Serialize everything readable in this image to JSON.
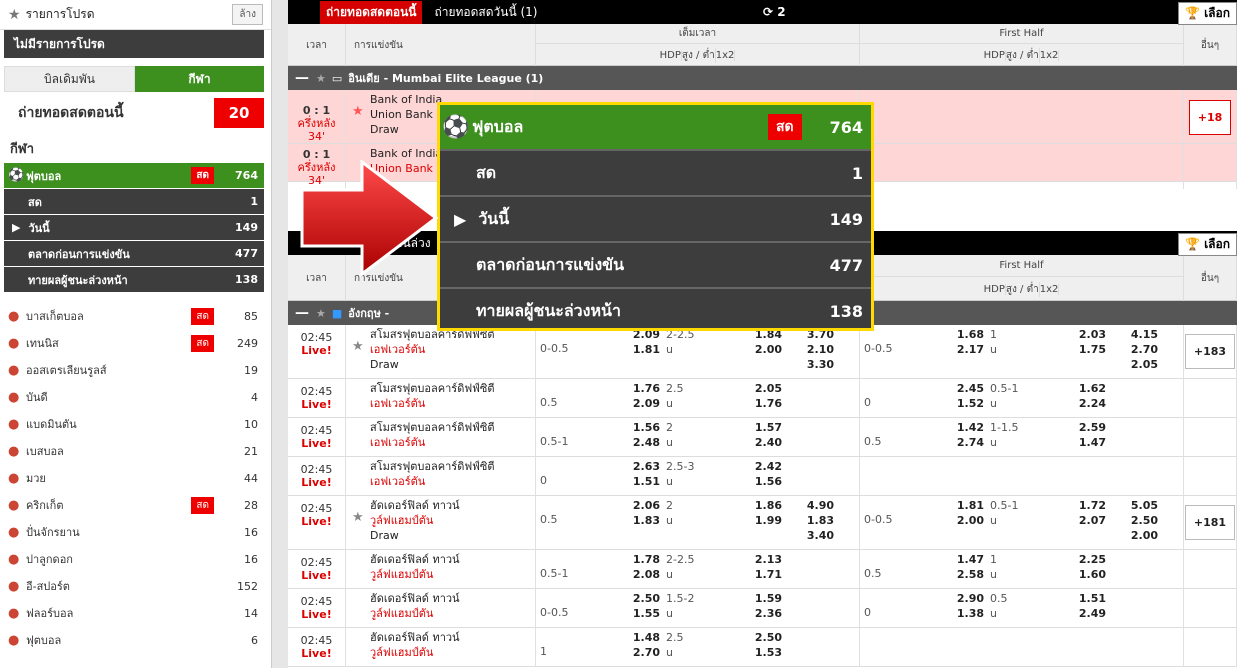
{
  "sidebar": {
    "fav_title": "รายการโปรด",
    "clear": "ล้าง",
    "no_fav": "ไม่มีรายการโปรด",
    "tab_bets": "บิลเดิมพัน",
    "tab_sports": "กีฬา",
    "live_now_label": "ถ่ายทอดสดตอนนี้",
    "live_now_count": "20",
    "sports_header": "กีฬา",
    "football": {
      "label": "ฟุตบอล",
      "live": "สด",
      "count": "764"
    },
    "subs": [
      {
        "label": "สด",
        "count": "1"
      },
      {
        "label": "วันนี้",
        "count": "149"
      },
      {
        "label": "ตลาดก่อนการแข่งขัน",
        "count": "477"
      },
      {
        "label": "ทายผลผู้ชนะล่วงหน้า",
        "count": "138"
      }
    ],
    "sports": [
      {
        "icon": "●",
        "label": "บาสเก็ตบอล",
        "live": "สด",
        "count": "85"
      },
      {
        "icon": "●",
        "label": "เทนนิส",
        "live": "สด",
        "count": "249"
      },
      {
        "icon": "●",
        "label": "ออสเตรเลียนรูลส์",
        "live": "",
        "count": "19"
      },
      {
        "icon": "●",
        "label": "บันดี",
        "live": "",
        "count": "4"
      },
      {
        "icon": "●",
        "label": "แบดมินตัน",
        "live": "",
        "count": "10"
      },
      {
        "icon": "●",
        "label": "เบสบอล",
        "live": "",
        "count": "21"
      },
      {
        "icon": "●",
        "label": "มวย",
        "live": "",
        "count": "44"
      },
      {
        "icon": "●",
        "label": "คริกเก็ต",
        "live": "สด",
        "count": "28"
      },
      {
        "icon": "●",
        "label": "ปั่นจักรยาน",
        "live": "",
        "count": "16"
      },
      {
        "icon": "●",
        "label": "ปาลูกดอก",
        "live": "",
        "count": "16"
      },
      {
        "icon": "●",
        "label": "อี-สปอร์ต",
        "live": "",
        "count": "152"
      },
      {
        "icon": "●",
        "label": "ฟลอร์บอล",
        "live": "",
        "count": "14"
      },
      {
        "icon": "●",
        "label": "ฟุตบอล",
        "live": "",
        "count": "6"
      }
    ]
  },
  "top": {
    "live_now": "ถ่ายทอดสดตอนนี้",
    "live_today": "ถ่ายทอดสดวันนี้ (1)",
    "refresh": "2",
    "choose": "เลือก"
  },
  "header": {
    "time": "เวลา",
    "match": "การแข่งขัน",
    "full": "เต็มเวลา",
    "first_half": "First Half",
    "hdp": "HDP",
    "ou": "สูง / ต่ำ",
    "x12": "1x2",
    "other": "อื่นๆ"
  },
  "league1": "อินเดีย - Mumbai Elite League (1)",
  "live_rows": [
    {
      "score": "0 : 1",
      "period": "ครึ่งหลัง 34'",
      "home": "Bank of India",
      "away": "Union Bank",
      "draw": "Draw",
      "more": "+18"
    },
    {
      "score": "0 : 1",
      "period": "ครึ่งหลัง 34'",
      "home": "Bank of India",
      "away": "Union Bank",
      "draw": "",
      "more": ""
    }
  ],
  "league2": "อังกฤษ -",
  "rows": [
    {
      "time": "02:45",
      "live": "Live!",
      "home": "สโมสรฟุตบอลคาร์ดิฟฟ์ซิตี",
      "away": "เอฟเวอร์ตัน",
      "draw": "Draw",
      "fh": "0-0.5",
      "fo1": "2.09",
      "fo2": "1.81",
      "fou": "2-2.5",
      "fu": "u",
      "fuo1": "1.84",
      "fuo2": "2.00",
      "x1": "3.70",
      "x2": "2.10",
      "x3": "3.30",
      "hh": "0-0.5",
      "ho1": "1.68",
      "ho2": "2.17",
      "hou": "1",
      "hu": "u",
      "huo1": "2.03",
      "huo2": "1.75",
      "hx1": "4.15",
      "hx2": "2.70",
      "hx3": "2.05",
      "more": "+183"
    },
    {
      "time": "02:45",
      "live": "Live!",
      "home": "สโมสรฟุตบอลคาร์ดิฟฟ์ซิตี",
      "away": "เอฟเวอร์ตัน",
      "draw": "",
      "fh": "0.5",
      "fo1": "1.76",
      "fo2": "2.09",
      "fou": "2.5",
      "fu": "u",
      "fuo1": "2.05",
      "fuo2": "1.76",
      "x1": "",
      "x2": "",
      "x3": "",
      "hh": "0",
      "ho1": "2.45",
      "ho2": "1.52",
      "hou": "0.5-1",
      "hu": "u",
      "huo1": "1.62",
      "huo2": "2.24",
      "hx1": "",
      "hx2": "",
      "hx3": "",
      "more": ""
    },
    {
      "time": "02:45",
      "live": "Live!",
      "home": "สโมสรฟุตบอลคาร์ดิฟฟ์ซิตี",
      "away": "เอฟเวอร์ตัน",
      "draw": "",
      "fh": "0.5-1",
      "fo1": "1.56",
      "fo2": "2.48",
      "fou": "2",
      "fu": "u",
      "fuo1": "1.57",
      "fuo2": "2.40",
      "x1": "",
      "x2": "",
      "x3": "",
      "hh": "0.5",
      "ho1": "1.42",
      "ho2": "2.74",
      "hou": "1-1.5",
      "hu": "u",
      "huo1": "2.59",
      "huo2": "1.47",
      "hx1": "",
      "hx2": "",
      "hx3": "",
      "more": ""
    },
    {
      "time": "02:45",
      "live": "Live!",
      "home": "สโมสรฟุตบอลคาร์ดิฟฟ์ซิตี",
      "away": "เอฟเวอร์ตัน",
      "draw": "",
      "fh": "0",
      "fo1": "2.63",
      "fo2": "1.51",
      "fou": "2.5-3",
      "fu": "u",
      "fuo1": "2.42",
      "fuo2": "1.56",
      "x1": "",
      "x2": "",
      "x3": "",
      "hh": "",
      "ho1": "",
      "ho2": "",
      "hou": "",
      "hu": "",
      "huo1": "",
      "huo2": "",
      "hx1": "",
      "hx2": "",
      "hx3": "",
      "more": ""
    },
    {
      "time": "02:45",
      "live": "Live!",
      "home": "ฮัดเดอร์ฟิลด์ ทาวน์",
      "away": "วูล์ฟแฮมป์ตัน",
      "draw": "Draw",
      "fh": "0.5",
      "fo1": "2.06",
      "fo2": "1.83",
      "fou": "2",
      "fu": "u",
      "fuo1": "1.86",
      "fuo2": "1.99",
      "x1": "4.90",
      "x2": "1.83",
      "x3": "3.40",
      "hh": "0-0.5",
      "ho1": "1.81",
      "ho2": "2.00",
      "hou": "0.5-1",
      "hu": "u",
      "huo1": "1.72",
      "huo2": "2.07",
      "hx1": "5.05",
      "hx2": "2.50",
      "hx3": "2.00",
      "more": "+181"
    },
    {
      "time": "02:45",
      "live": "Live!",
      "home": "ฮัดเดอร์ฟิลด์ ทาวน์",
      "away": "วูล์ฟแฮมป์ตัน",
      "draw": "",
      "fh": "0.5-1",
      "fo1": "1.78",
      "fo2": "2.08",
      "fou": "2-2.5",
      "fu": "u",
      "fuo1": "2.13",
      "fuo2": "1.71",
      "x1": "",
      "x2": "",
      "x3": "",
      "hh": "0.5",
      "ho1": "1.47",
      "ho2": "2.58",
      "hou": "1",
      "hu": "u",
      "huo1": "2.25",
      "huo2": "1.60",
      "hx1": "",
      "hx2": "",
      "hx3": "",
      "more": ""
    },
    {
      "time": "02:45",
      "live": "Live!",
      "home": "ฮัดเดอร์ฟิลด์ ทาวน์",
      "away": "วูล์ฟแฮมป์ตัน",
      "draw": "",
      "fh": "0-0.5",
      "fo1": "2.50",
      "fo2": "1.55",
      "fou": "1.5-2",
      "fu": "u",
      "fuo1": "1.59",
      "fuo2": "2.36",
      "x1": "",
      "x2": "",
      "x3": "",
      "hh": "0",
      "ho1": "2.90",
      "ho2": "1.38",
      "hou": "0.5",
      "hu": "u",
      "huo1": "1.51",
      "huo2": "2.49",
      "hx1": "",
      "hx2": "",
      "hx3": "",
      "more": ""
    },
    {
      "time": "02:45",
      "live": "Live!",
      "home": "ฮัดเดอร์ฟิลด์ ทาวน์",
      "away": "วูล์ฟแฮมป์ตัน",
      "draw": "",
      "fh": "1",
      "fo1": "1.48",
      "fo2": "2.70",
      "fou": "2.5",
      "fu": "u",
      "fuo1": "2.50",
      "fuo2": "1.53",
      "x1": "",
      "x2": "",
      "x3": "",
      "hh": "",
      "ho1": "",
      "ho2": "",
      "hou": "",
      "hu": "",
      "huo1": "",
      "huo2": "",
      "hx1": "",
      "hx2": "",
      "hx3": "",
      "more": ""
    }
  ],
  "section2_title": "การแข่งขันล่วง",
  "popup": {
    "title": "ฟุตบอล",
    "live": "สด",
    "count": "764",
    "rows": [
      {
        "label": "สด",
        "count": "1"
      },
      {
        "label": "วันนี้",
        "count": "149"
      },
      {
        "label": "ตลาดก่อนการแข่งขัน",
        "count": "477"
      },
      {
        "label": "ทายผลผู้ชนะล่วงหน้า",
        "count": "138"
      }
    ]
  }
}
